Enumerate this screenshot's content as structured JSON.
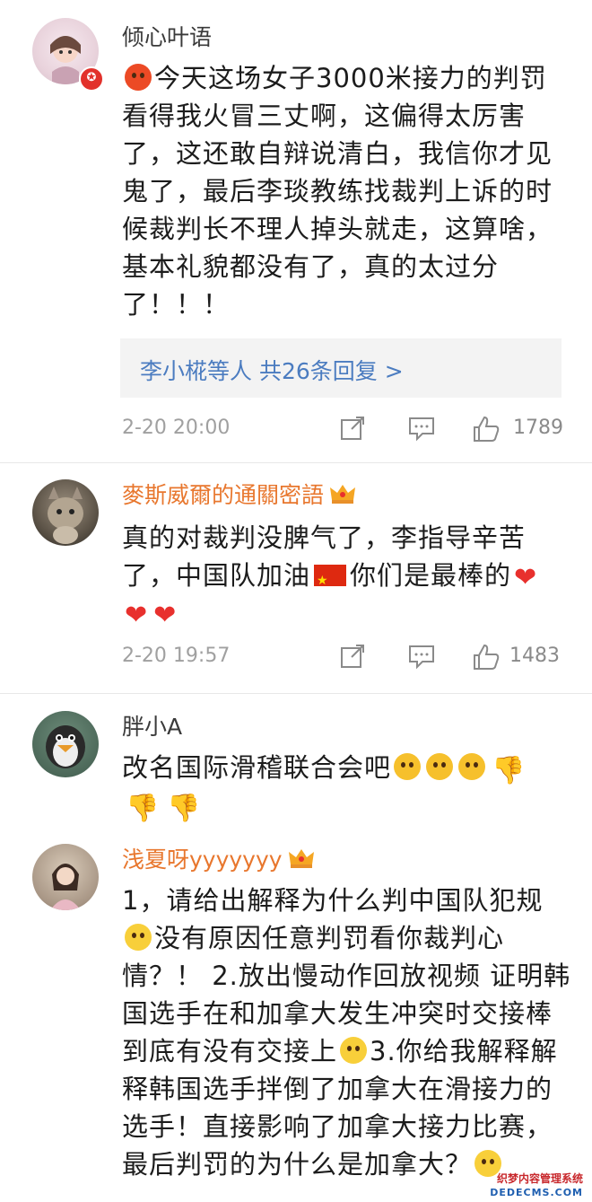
{
  "comments": [
    {
      "username": "倾心叶语",
      "lines": [
        "今天这场女子3000米接力的判罚",
        "看得我火冒三丈啊，这偏得太厉害",
        "了，这还敢自辩说清白，我信你才见",
        "鬼了，最后李琰教练找裁判上诉的时",
        "候裁判长不理人掉头就走，这算啥，",
        "基本礼貌都没有了，真的太过分",
        "了！！！"
      ],
      "reply_summary": "李小椛等人 共26条回复 >",
      "time": "2-20 20:00",
      "likes": "1789"
    },
    {
      "username": "麥斯威爾的通關密語",
      "line1": "真的对裁判没脾气了，李指导辛苦",
      "line2a": "了，中国队加油",
      "line2b": "你们是最棒的",
      "time": "2-20 19:57",
      "likes": "1483"
    },
    {
      "username": "胖小A",
      "line1": "改名国际滑稽联合会吧"
    },
    {
      "username": "浅夏呀yyyyyyy",
      "line1": "1，请给出解释为什么判中国队犯规",
      "line2": "没有原因任意判罚看你裁判心",
      "line3": "情？！ 2.放出慢动作回放视频 证明韩",
      "line4": "国选手在和加拿大发生冲突时交接棒",
      "line5a": "到底有没有交接上",
      "line5b": "3.你给我解释解",
      "line6": "释韩国选手拌倒了加拿大在滑接力的",
      "line7": "选手！直接影响了加拿大接力比赛，",
      "line8": "最后判罚的为什么是加拿大？"
    }
  ],
  "watermark": {
    "line1": "织梦内容管理系统",
    "line2": "DEDECMS.COM"
  },
  "icons": {
    "share": "share-icon",
    "comment": "comment-icon",
    "like": "thumbs-up-icon"
  }
}
